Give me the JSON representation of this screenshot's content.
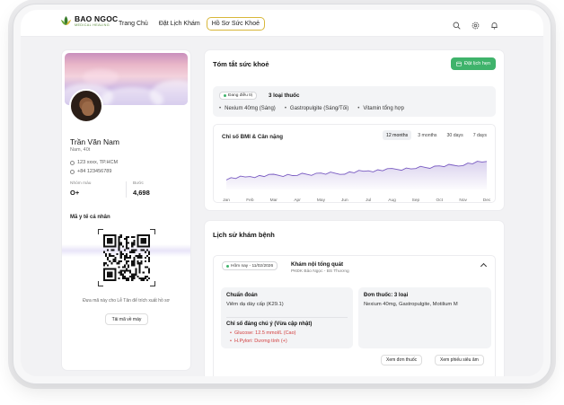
{
  "brand": {
    "name": "BAO NGOC",
    "tagline": "MEDICAL HEALING",
    "green": "#3fb36b",
    "gold": "#d8b73a"
  },
  "nav": {
    "items": [
      "Trang Chủ",
      "Đặt Lịch Khám",
      "Hồ Sơ Sức Khoẻ"
    ],
    "active_index": 2
  },
  "header_icons": [
    "search-icon",
    "gear-icon",
    "bell-icon"
  ],
  "profile": {
    "name": "Trần Văn Nam",
    "subtitle": "Nam, 40t",
    "address": "123 xxxx, TP.HCM",
    "phone": "+84 123456789",
    "blood_label": "Nhóm máu",
    "blood_value": "O+",
    "steps_label": "Bước",
    "steps_value": "4,698"
  },
  "qr": {
    "title": "Mã y tế cá nhân",
    "hint": "Đưa mã này cho Lễ Tân để trích xuất hồ sơ",
    "download_label": "Tải mã về máy"
  },
  "summary": {
    "title": "Tóm tắt sức khoẻ",
    "book_button": "Đặt lịch hẹn",
    "treatment_pill": "Đang điều trị",
    "medication_count": "3 loại thuốc",
    "medications": [
      "Nexium 40mg (Sáng)",
      "Gastropulgite (Sáng/Tối)",
      "Vitamin tổng hợp"
    ]
  },
  "chart_data": {
    "type": "line",
    "title": "Chỉ số BMI & Cân nặng",
    "ranges": [
      "12 months",
      "3 months",
      "30 days",
      "7 days"
    ],
    "active_range": "12 months",
    "categories": [
      "Jan",
      "Feb",
      "Mar",
      "Apr",
      "May",
      "Jun",
      "Jul",
      "Aug",
      "Sep",
      "Oct",
      "Nov",
      "Dec"
    ],
    "values": [
      0.3,
      0.36,
      0.39,
      0.41,
      0.44,
      0.46,
      0.52,
      0.55,
      0.6,
      0.64,
      0.7,
      0.78
    ],
    "ylim": [
      0,
      1
    ],
    "line_color": "#7a5cc2",
    "area": true,
    "grid": false
  },
  "history": {
    "title": "Lịch sử khám bệnh",
    "visit": {
      "date": "Hôm nay - 11/02/2026",
      "title": "Khám nội tổng quát",
      "subtitle": "PKĐK Bảo Ngọc - BS Thương",
      "diagnosis_label": "Chuẩn đoán",
      "diagnosis": "Viêm dạ dày cấp (K29.1)",
      "alerts_label": "Chỉ số đáng chú ý (Vừa cập nhật)",
      "alerts": [
        "Glucose: 12.5 mmol/L (Cao)",
        "H.Pylori: Dương tính (+)"
      ],
      "rx_label": "Đơn thuốc: 3 loại",
      "rx_list": "Nexium 40mg, Gastropulgite, Motilium M",
      "view_rx_button": "Xem đơn thuốc",
      "view_ultrasound_button": "Xem phiếu siêu âm"
    }
  }
}
